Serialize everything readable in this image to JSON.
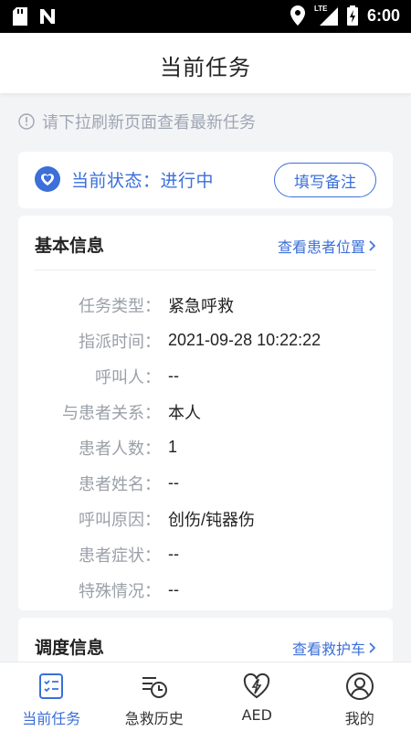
{
  "status_bar": {
    "time": "6:00",
    "network": "LTE"
  },
  "header": {
    "title": "当前任务"
  },
  "notice": {
    "text": "请下拉刷新页面查看最新任务"
  },
  "status_card": {
    "status_text": "当前状态：进行中",
    "note_button": "填写备注"
  },
  "basic_info": {
    "title": "基本信息",
    "link": "查看患者位置",
    "rows": [
      {
        "label": "任务类型：",
        "value": "紧急呼救"
      },
      {
        "label": "指派时间：",
        "value": "2021-09-28 10:22:22"
      },
      {
        "label": "呼叫人：",
        "value": "--"
      },
      {
        "label": "与患者关系：",
        "value": "本人"
      },
      {
        "label": "患者人数：",
        "value": "1"
      },
      {
        "label": "患者姓名：",
        "value": "--"
      },
      {
        "label": "呼叫原因：",
        "value": "创伤/钝器伤"
      },
      {
        "label": "患者症状：",
        "value": "--"
      },
      {
        "label": "特殊情况：",
        "value": "--"
      }
    ]
  },
  "dispatch_info": {
    "title": "调度信息",
    "link": "查看救护车"
  },
  "nav": {
    "items": [
      {
        "label": "当前任务",
        "icon": "task-list-icon",
        "active": true
      },
      {
        "label": "急救历史",
        "icon": "history-icon",
        "active": false
      },
      {
        "label": "AED",
        "icon": "aed-heart-icon",
        "active": false
      },
      {
        "label": "我的",
        "icon": "profile-icon",
        "active": false
      }
    ]
  },
  "colors": {
    "accent": "#3b6fd9",
    "muted": "#9aa0a8",
    "background": "#f3f4f6"
  }
}
